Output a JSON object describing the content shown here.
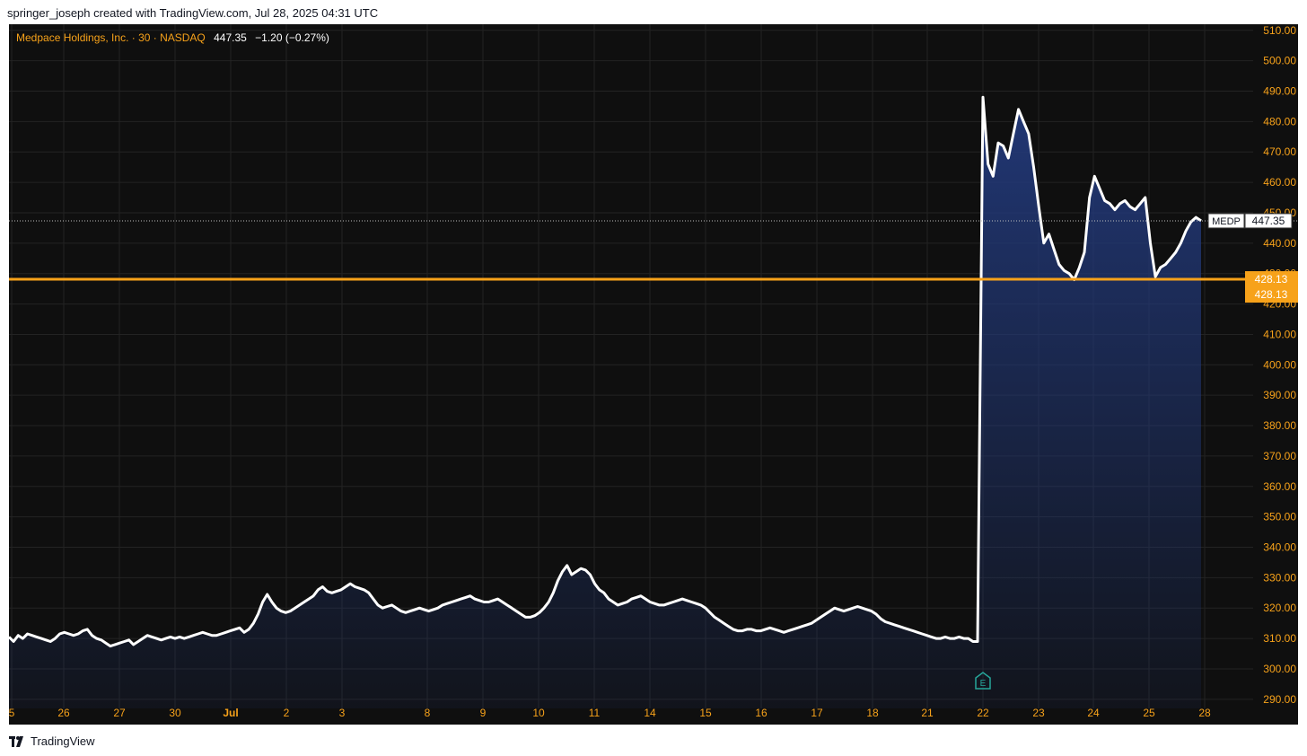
{
  "credit": "springer_joseph created with TradingView.com, Jul 28, 2025 04:31 UTC",
  "legend": {
    "symbol_text": "Medpace Holdings, Inc. · 30 · NASDAQ",
    "price": "447.35",
    "change": "−1.20 (−0.27%)"
  },
  "footer": {
    "brand": "TradingView"
  },
  "colors": {
    "background": "#0f0f0f",
    "grid": "#232323",
    "axis_text": "#f7a21a",
    "line": "#ffffff",
    "area_top": "#22397a",
    "hline": "#f7a21a"
  },
  "chart_data": {
    "type": "area",
    "title": "Medpace Holdings, Inc. · 30 · NASDAQ",
    "ylim": [
      287,
      512
    ],
    "grid": true,
    "y_ticks": [
      "290.00",
      "300.00",
      "310.00",
      "320.00",
      "330.00",
      "340.00",
      "350.00",
      "360.00",
      "370.00",
      "380.00",
      "390.00",
      "400.00",
      "410.00",
      "420.00",
      "430.00",
      "440.00",
      "450.00",
      "460.00",
      "470.00",
      "480.00",
      "490.00",
      "500.00",
      "510.00"
    ],
    "x_labels": [
      "5",
      "26",
      "27",
      "30",
      "Jul",
      "2",
      "3",
      "8",
      "9",
      "10",
      "11",
      "14",
      "15",
      "16",
      "17",
      "18",
      "21",
      "22",
      "23",
      "24",
      "25",
      "28"
    ],
    "series": [
      {
        "name": "MEDP",
        "values": [
          310.5,
          309,
          311,
          310,
          311.5,
          311,
          310.5,
          310,
          309.5,
          309,
          310,
          311.5,
          312,
          311.5,
          311,
          311.5,
          312.5,
          313,
          311,
          310,
          309.5,
          308.5,
          307.5,
          308,
          308.5,
          309,
          309.5,
          308,
          309,
          310,
          311,
          310.5,
          310,
          309.5,
          310,
          310.5,
          310,
          310.5,
          310,
          310.5,
          311,
          311.5,
          312,
          311.5,
          311,
          311,
          311.5,
          312,
          312.5,
          313,
          313.5,
          312,
          313,
          315,
          318,
          322,
          324.5,
          322,
          320,
          319,
          318.5,
          319,
          320,
          321,
          322,
          323,
          324,
          326,
          327,
          325.5,
          325,
          325.5,
          326,
          327,
          328,
          327,
          326.5,
          326,
          325,
          323,
          321,
          320,
          320.5,
          321,
          320,
          319,
          318.5,
          319,
          319.5,
          320,
          319.5,
          319,
          319.5,
          320,
          321,
          321.5,
          322,
          322.5,
          323,
          323.5,
          324,
          323,
          322.5,
          322,
          322,
          322.5,
          323,
          322,
          321,
          320,
          319,
          318,
          317,
          317,
          317.5,
          318.5,
          320,
          322,
          325,
          329,
          332,
          334,
          331,
          332,
          333,
          332.5,
          331,
          328,
          326,
          325,
          323,
          322,
          321,
          321.5,
          322,
          323,
          323.5,
          324,
          323,
          322,
          321.5,
          321,
          321,
          321.5,
          322,
          322.5,
          323,
          322.5,
          322,
          321.5,
          321,
          320,
          318.5,
          317,
          316,
          315,
          314,
          313,
          312.5,
          312.5,
          313,
          313,
          312.5,
          312.5,
          313,
          313.5,
          313,
          312.5,
          312,
          312.5,
          313,
          313.5,
          314,
          314.5,
          315,
          316,
          317,
          318,
          319,
          320,
          319.5,
          319,
          319.5,
          320,
          320.5,
          320,
          319.5,
          319,
          318,
          316.5,
          315.5,
          315,
          314.5,
          314,
          313.5,
          313,
          312.5,
          312,
          311.5,
          311,
          310.5,
          310,
          310,
          310.5,
          310,
          310,
          310.5,
          310,
          310,
          309,
          309,
          488,
          466,
          462,
          473,
          472,
          468,
          476,
          484,
          480,
          476,
          465,
          452,
          440,
          443,
          438,
          433,
          431,
          430,
          428,
          432,
          437,
          455,
          462,
          458,
          454,
          453,
          451,
          453,
          454,
          452,
          451,
          453,
          455,
          440,
          429,
          432,
          433,
          435,
          437,
          440,
          444,
          447,
          448.5,
          447.35
        ]
      }
    ],
    "last_price": {
      "label": "MEDP",
      "value": "447.35"
    },
    "hline": {
      "value": 428.13,
      "label": "428.13"
    },
    "close_label": "428.13",
    "event_marker": "E"
  }
}
